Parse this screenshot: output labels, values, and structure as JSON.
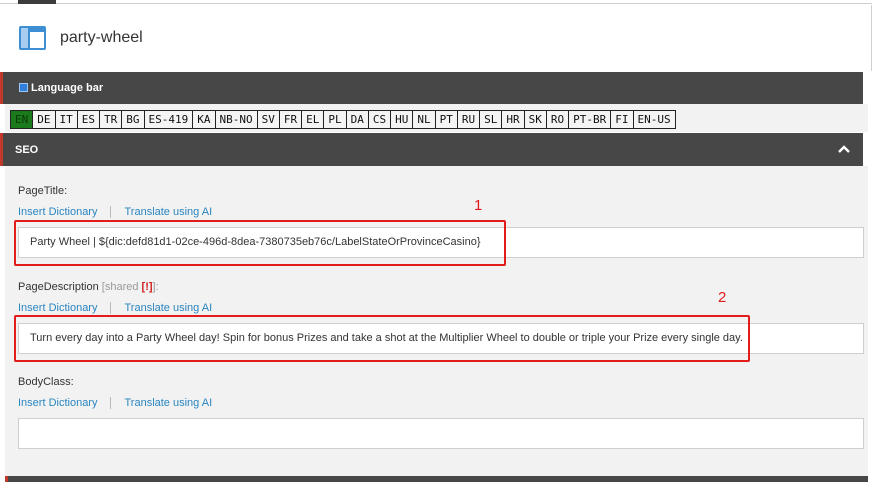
{
  "header": {
    "title": "party-wheel",
    "icon": "layout-panel-icon"
  },
  "language_panel": {
    "title": "Language bar",
    "active": "EN",
    "languages": [
      "EN",
      "DE",
      "IT",
      "ES",
      "TR",
      "BG",
      "ES-419",
      "KA",
      "NB-NO",
      "SV",
      "FR",
      "EL",
      "PL",
      "DA",
      "CS",
      "HU",
      "NL",
      "PT",
      "RU",
      "SL",
      "HR",
      "SK",
      "RO",
      "PT-BR",
      "FI",
      "EN-US"
    ]
  },
  "seo_panel": {
    "title": "SEO",
    "collapse_icon": "chevron-up-icon",
    "insert_dictionary": "Insert Dictionary",
    "translate_ai": "Translate using AI",
    "page_title": {
      "label": "PageTitle:",
      "value": "Party Wheel | ${dic:defd81d1-02ce-496d-8dea-7380735eb76c/LabelStateOrProvinceCasino}"
    },
    "page_description": {
      "label": "PageDescription",
      "shared": "[shared",
      "warn": "[!]",
      "suffix": "]:",
      "value": "Turn every day into a Party Wheel day! Spin for bonus Prizes and take a shot at the Multiplier Wheel to double or triple your Prize every single day."
    },
    "body_class": {
      "label": "BodyClass:",
      "value": ""
    }
  },
  "annotations": [
    "1",
    "2"
  ],
  "colors": {
    "accent_red": "#e21b1b",
    "header_bg": "#474747",
    "link": "#2a86c0",
    "active_lang": "#1b7a1b"
  }
}
